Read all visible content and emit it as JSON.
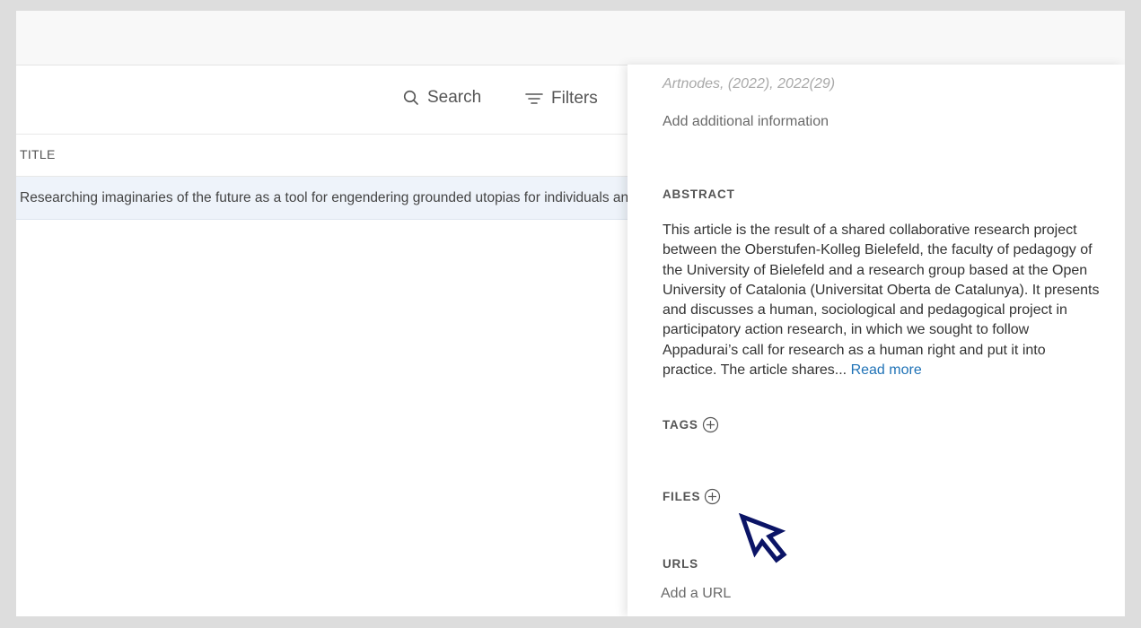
{
  "toolbar": {
    "search_label": "Search",
    "filters_label": "Filters"
  },
  "table": {
    "columns": [
      "TITLE"
    ],
    "rows": [
      {
        "title": "Researching imaginaries of the future as a tool for engendering grounded utopias for individuals and communities"
      }
    ]
  },
  "details": {
    "citation": "Artnodes, (2022), 2022(29)",
    "add_info_label": "Add additional information",
    "abstract_label": "ABSTRACT",
    "abstract_text": "This article is the result of a shared collaborative research project between the Oberstufen-Kolleg Bielefeld, the faculty of pedagogy of the University of Bielefeld and a research group based at the Open University of Catalonia (Universitat Oberta de Catalunya). It presents and discusses a human, sociological and pedagogical project in participatory action research, in which we sought to follow Appadurai’s call for research as a human right and put it into practice. The article shares...",
    "read_more_label": "Read more",
    "tags_label": "TAGS",
    "files_label": "FILES",
    "urls_label": "URLS",
    "add_url_label": "Add a URL"
  },
  "icons": {
    "search": "search-icon",
    "filters": "filter-icon",
    "add": "plus-circle-icon",
    "pointer": "mouse-pointer-icon"
  },
  "colors": {
    "accent_link": "#1f72b6",
    "selected_row": "#eef3fa",
    "cursor": "#0b1466"
  }
}
